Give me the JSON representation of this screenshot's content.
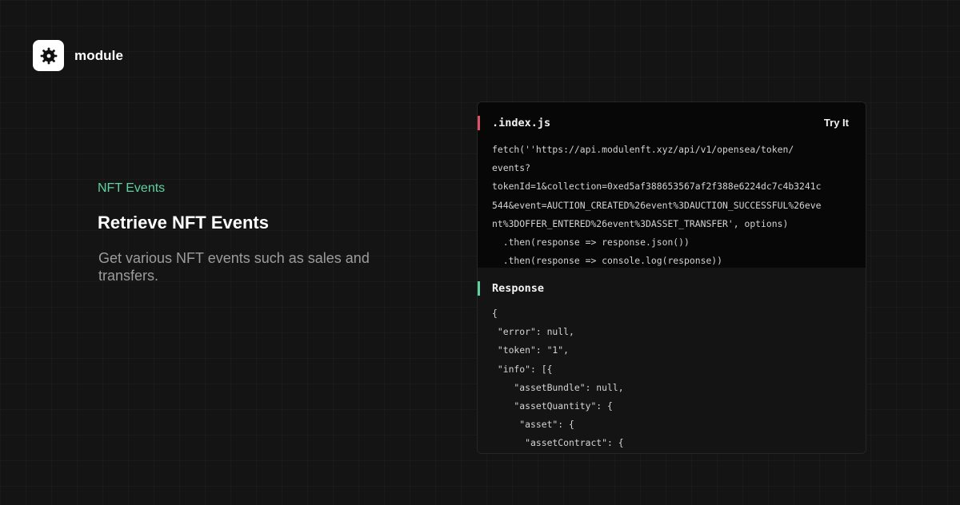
{
  "brand": {
    "name": "module"
  },
  "hero": {
    "eyebrow": "NFT Events",
    "title": "Retrieve NFT Events",
    "subtitle": "Get various NFT events such as sales and transfers."
  },
  "code_card": {
    "request": {
      "filename": ".index.js",
      "try_label": "Try It",
      "code": "fetch(''https://api.modulenft.xyz/api/v1/opensea/token/\nevents?\ntokenId=1&collection=0xed5af388653567af2f388e6224dc7c4b3241c\n544&event=AUCTION_CREATED%26event%3DAUCTION_SUCCESSFUL%26eve\nnt%3DOFFER_ENTERED%26event%3DASSET_TRANSFER', options)\n  .then(response => response.json())\n  .then(response => console.log(response))"
    },
    "response": {
      "title": "Response",
      "code": "{\n \"error\": null,\n \"token\": \"1\",\n \"info\": [{\n    \"assetBundle\": null,\n    \"assetQuantity\": {\n     \"asset\": {\n      \"assetContract\": {"
    }
  },
  "colors": {
    "accent_green": "#5fd1a1",
    "accent_red": "#e0506a",
    "accent_teal": "#5fd1a1"
  }
}
